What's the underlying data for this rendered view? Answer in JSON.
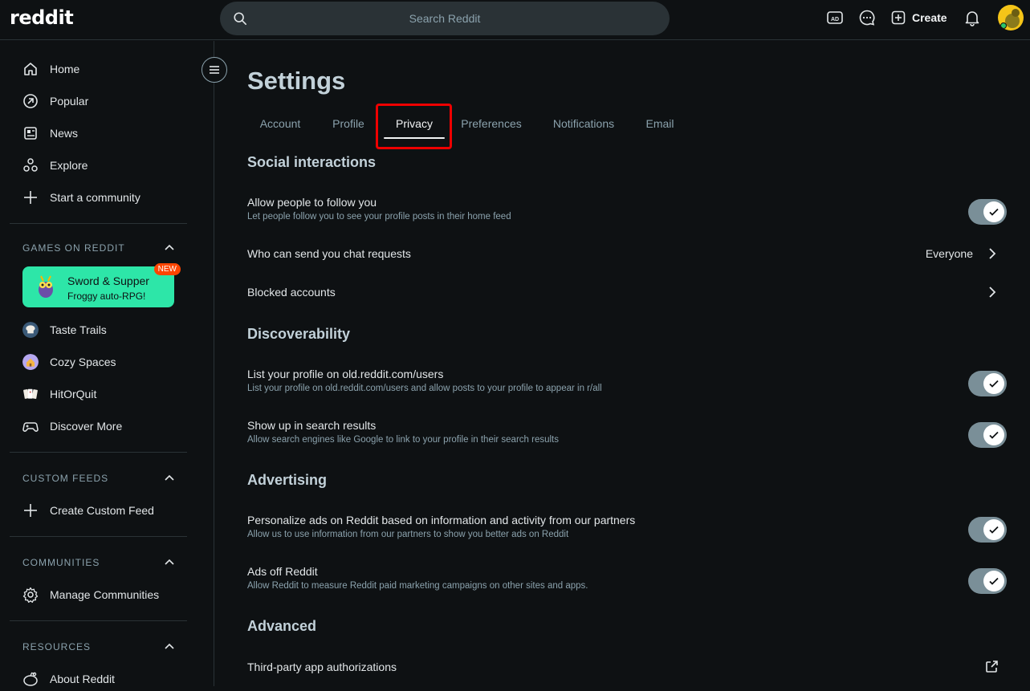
{
  "header": {
    "logo": "reddit",
    "search_placeholder": "Search Reddit",
    "create_label": "Create",
    "icons": [
      "advertise-icon",
      "chat-icon",
      "plus-square-icon",
      "bell-icon",
      "avatar"
    ]
  },
  "sidebar": {
    "nav": [
      {
        "label": "Home",
        "icon": "home-icon"
      },
      {
        "label": "Popular",
        "icon": "popular-icon"
      },
      {
        "label": "News",
        "icon": "news-icon"
      },
      {
        "label": "Explore",
        "icon": "explore-icon"
      },
      {
        "label": "Start a community",
        "icon": "plus-icon"
      }
    ],
    "games": {
      "heading": "GAMES ON REDDIT",
      "featured": {
        "title": "Sword & Supper",
        "subtitle": "Froggy auto-RPG!",
        "badge": "NEW"
      },
      "items": [
        {
          "label": "Taste Trails",
          "icon": "chef-hat-icon"
        },
        {
          "label": "Cozy Spaces",
          "icon": "house-icon"
        },
        {
          "label": "HitOrQuit",
          "icon": "cards-icon"
        },
        {
          "label": "Discover More",
          "icon": "gamepad-icon"
        }
      ]
    },
    "custom_feeds": {
      "heading": "CUSTOM FEEDS",
      "items": [
        {
          "label": "Create Custom Feed"
        }
      ]
    },
    "communities": {
      "heading": "COMMUNITIES",
      "items": [
        {
          "label": "Manage Communities"
        }
      ]
    },
    "resources": {
      "heading": "RESOURCES",
      "items": [
        {
          "label": "About Reddit"
        }
      ]
    }
  },
  "main": {
    "title": "Settings",
    "tabs": [
      {
        "label": "Account"
      },
      {
        "label": "Profile"
      },
      {
        "label": "Privacy",
        "active": true
      },
      {
        "label": "Preferences"
      },
      {
        "label": "Notifications"
      },
      {
        "label": "Email"
      }
    ],
    "sections": {
      "social": {
        "title": "Social interactions",
        "follow": {
          "label": "Allow people to follow you",
          "desc": "Let people follow you to see your profile posts in their home feed",
          "enabled": true
        },
        "chat": {
          "label": "Who can send you chat requests",
          "value": "Everyone"
        },
        "blocked": {
          "label": "Blocked accounts"
        }
      },
      "discoverability": {
        "title": "Discoverability",
        "old_reddit": {
          "label": "List your profile on old.reddit.com/users",
          "desc": "List your profile on old.reddit.com/users and allow posts to your profile to appear in r/all",
          "enabled": true
        },
        "search": {
          "label": "Show up in search results",
          "desc": "Allow search engines like Google to link to your profile in their search results",
          "enabled": true
        }
      },
      "advertising": {
        "title": "Advertising",
        "personalize": {
          "label": "Personalize ads on Reddit based on information and activity from our partners",
          "desc": "Allow us to use information from our partners to show you better ads on Reddit",
          "enabled": true
        },
        "ads_off": {
          "label": "Ads off Reddit",
          "desc": "Allow Reddit to measure Reddit paid marketing campaigns on other sites and apps.",
          "enabled": true
        }
      },
      "advanced": {
        "title": "Advanced",
        "third_party": {
          "label": "Third-party app authorizations"
        }
      }
    }
  }
}
